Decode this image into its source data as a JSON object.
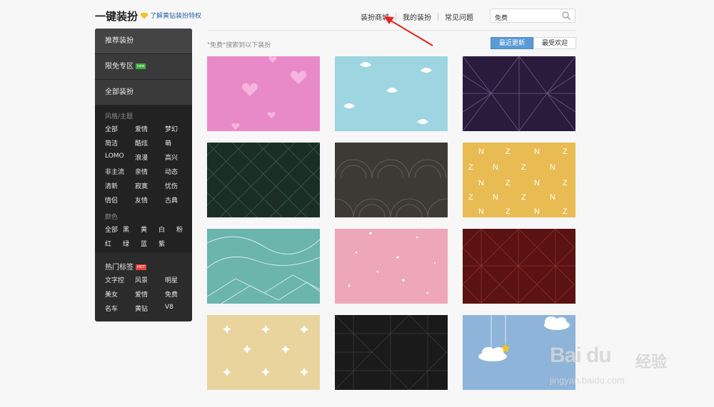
{
  "header": {
    "title": "一键装扮",
    "vip_link": "了解黄钻装扮特权",
    "nav": [
      "装扮商城",
      "我的装扮",
      "常见问题"
    ],
    "search_value": "免费"
  },
  "sidebar": {
    "items": [
      {
        "label": "推荐装扮"
      },
      {
        "label": "限免专区",
        "badge": "new"
      },
      {
        "label": "全部装扮"
      }
    ],
    "style_group": {
      "title": "风格/主题",
      "tags": [
        "全部",
        "爱情",
        "梦幻",
        "简洁",
        "酷炫",
        "萌",
        "LOMO",
        "浪漫",
        "高兴",
        "非主流",
        "亲情",
        "动态",
        "清新",
        "寂寞",
        "忧伤",
        "情侣",
        "友情",
        "古典"
      ]
    },
    "color_group": {
      "title": "颜色",
      "tags": [
        "全部",
        "黑",
        "黄",
        "白",
        "粉",
        "红",
        "绿",
        "蓝",
        "紫"
      ]
    },
    "hot_group": {
      "title": "热门标签",
      "badge": "HOT",
      "tags": [
        "文字控",
        "风景",
        "明星",
        "美女",
        "爱情",
        "免费",
        "名车",
        "黄钻",
        "V8"
      ]
    }
  },
  "results": {
    "text": "\"免费\"搜索到以下装扮",
    "sort": [
      "最近更新",
      "最受欢迎"
    ]
  },
  "tiles": [
    {
      "name": "pink-hearts",
      "color": "#e98ac8"
    },
    {
      "name": "cyan-birds",
      "color": "#9dd5e0"
    },
    {
      "name": "purple-geometric",
      "color": "#2a1a3c"
    },
    {
      "name": "green-diamonds",
      "color": "#1b2e25"
    },
    {
      "name": "brown-waves",
      "color": "#3d3a36"
    },
    {
      "name": "yellow-letters",
      "color": "#e8bc52"
    },
    {
      "name": "teal-lines",
      "color": "#6bb5ad"
    },
    {
      "name": "pink-dots",
      "color": "#eea6b9"
    },
    {
      "name": "maroon-geometric",
      "color": "#5a1212"
    },
    {
      "name": "cream-stars",
      "color": "#ead49e"
    },
    {
      "name": "black-geometric",
      "color": "#1a1a1a"
    },
    {
      "name": "blue-clouds",
      "color": "#8eb4d9"
    }
  ],
  "watermark": {
    "brand": "Bai du",
    "cn": "经验",
    "url": "jingyan.baidu.com"
  }
}
